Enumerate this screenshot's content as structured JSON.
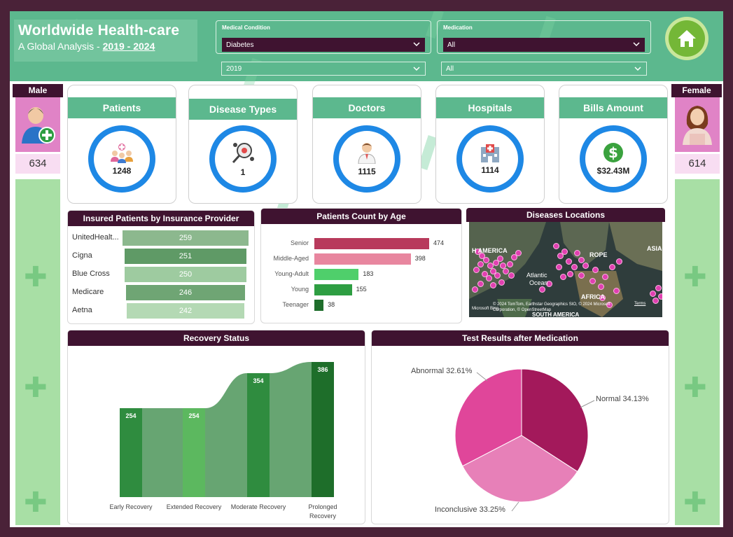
{
  "header": {
    "title": "Worldwide Health-care",
    "subtitle_prefix": "A Global Analysis - ",
    "subtitle_years": "2019 - 2024"
  },
  "slicers": {
    "condition": {
      "label": "Medical Condition",
      "value": "Diabetes"
    },
    "medication": {
      "label": "Medication",
      "value": "All"
    },
    "year": {
      "value": "2019"
    },
    "extra": {
      "value": "All"
    }
  },
  "gender": {
    "male": {
      "label": "Male",
      "count": "634"
    },
    "female": {
      "label": "Female",
      "count": "614"
    }
  },
  "kpis": [
    {
      "label": "Patients",
      "value": "1248",
      "icon": "patients-icon"
    },
    {
      "label": "Disease Types",
      "value": "1",
      "icon": "virus-icon"
    },
    {
      "label": "Doctors",
      "value": "1115",
      "icon": "doctor-icon"
    },
    {
      "label": "Hospitals",
      "value": "1114",
      "icon": "hospital-icon"
    },
    {
      "label": "Bills Amount",
      "value": "$32.43M",
      "icon": "dollar-icon"
    }
  ],
  "insurance": {
    "title": "Insured Patients by Insurance Provider",
    "chart_data": {
      "type": "bar",
      "categories": [
        "UnitedHealt...",
        "Cigna",
        "Blue Cross",
        "Medicare",
        "Aetna"
      ],
      "values": [
        259,
        251,
        250,
        246,
        242
      ],
      "colors": [
        "#8cb88e",
        "#5f9a66",
        "#9ecba0",
        "#6fa574",
        "#b4d9b4"
      ]
    }
  },
  "age": {
    "title": "Patients Count by Age",
    "chart_data": {
      "type": "bar",
      "categories": [
        "Senior",
        "Middle-Aged",
        "Young-Adult",
        "Young",
        "Teenager"
      ],
      "values": [
        474,
        398,
        183,
        155,
        38
      ],
      "colors": [
        "#b83a5c",
        "#e8869f",
        "#4fcf6b",
        "#2e9e42",
        "#1f6e2c"
      ]
    }
  },
  "map": {
    "title": "Diseases Locations",
    "labels": [
      "H AMERICA",
      "ROPE",
      "ASIA",
      "Atlantic",
      "Ocean",
      "AFRICA",
      "SOUTH AMERICA"
    ],
    "attribution": "© 2024 TomTom, Earthstar Geographics SIO, © 2024 Microsoft Corporation, © OpenStreetMap",
    "bing": "Microsoft Bing",
    "terms": "Terms"
  },
  "recovery": {
    "title": "Recovery Status",
    "chart_data": {
      "type": "bar",
      "categories": [
        "Early Recovery",
        "Extended Recovery",
        "Moderate Recovery",
        "Prolonged Recovery"
      ],
      "values": [
        254,
        254,
        354,
        386
      ],
      "ylim": [
        0,
        400
      ],
      "colors": [
        "#2f8c3f",
        "#5cb85f",
        "#2f8c3f",
        "#1e6e2a"
      ]
    }
  },
  "tests": {
    "title": "Test Results after Medication",
    "chart_data": {
      "type": "pie",
      "categories": [
        "Normal",
        "Inconclusive",
        "Abnormal"
      ],
      "values": [
        34.13,
        33.25,
        32.61
      ],
      "labels": [
        "Normal 34.13%",
        "Inconclusive 33.25%",
        "Abnormal 32.61%"
      ],
      "colors": [
        "#a3195b",
        "#e780b8",
        "#e0469a"
      ]
    }
  }
}
